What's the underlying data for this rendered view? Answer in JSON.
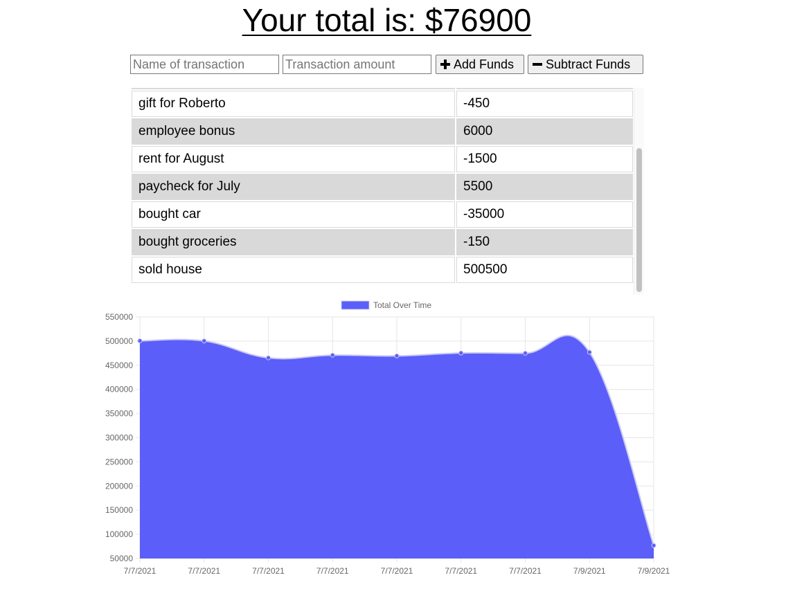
{
  "header": {
    "total_label": "Your total is: $76900"
  },
  "form": {
    "name_placeholder": "Name of transaction",
    "amount_placeholder": "Transaction amount",
    "add_label": "Add Funds",
    "subtract_label": "Subtract Funds"
  },
  "transactions": [
    {
      "name": "gift for Roberto",
      "amount": "-450"
    },
    {
      "name": "employee bonus",
      "amount": "6000"
    },
    {
      "name": "rent for August",
      "amount": "-1500"
    },
    {
      "name": "paycheck for July",
      "amount": "5500"
    },
    {
      "name": "bought car",
      "amount": "-35000"
    },
    {
      "name": "bought groceries",
      "amount": "-150"
    },
    {
      "name": "sold house",
      "amount": "500500"
    }
  ],
  "chart_data": {
    "type": "area",
    "legend": "Total Over Time",
    "legend_position": "top",
    "x": [
      "7/7/2021",
      "7/7/2021",
      "7/7/2021",
      "7/7/2021",
      "7/7/2021",
      "7/7/2021",
      "7/7/2021",
      "7/9/2021",
      "7/9/2021"
    ],
    "values": [
      500500,
      500350,
      465350,
      470850,
      469350,
      475350,
      474900,
      476900,
      76900
    ],
    "ylim": [
      50000,
      550000
    ],
    "y_ticks": [
      50000,
      100000,
      150000,
      200000,
      250000,
      300000,
      350000,
      400000,
      450000,
      500000,
      550000
    ],
    "grid": true,
    "fill_color": "#5b5ef9",
    "line_color": "#c8c8f4"
  }
}
